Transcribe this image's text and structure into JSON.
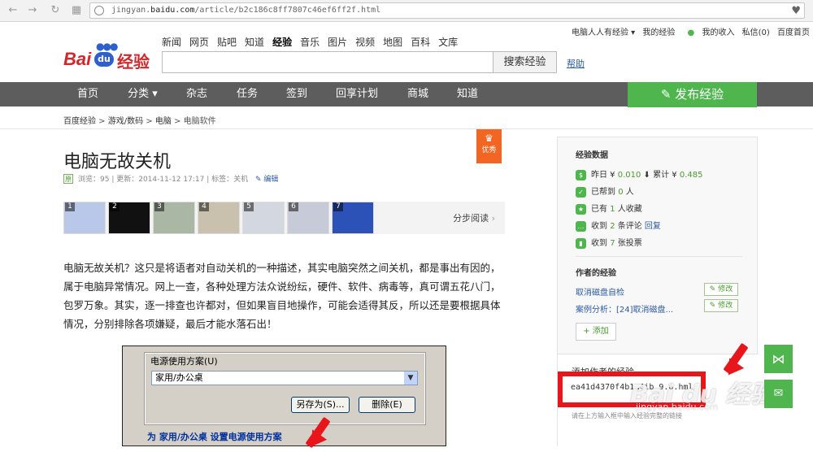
{
  "browser": {
    "url_prefix": "jingyan.",
    "url_domain": "baidu.com",
    "url_path": "/article/b2c186c8ff7807c46ef6ff2f.html"
  },
  "top_links": [
    "电脑人人有经验 ▾",
    "我的经验",
    "我的收入",
    "私信(0)",
    "百度首页"
  ],
  "logo": {
    "bai": "Bai",
    "du": "du",
    "jingyan": "经验"
  },
  "product_nav": [
    "新闻",
    "网页",
    "贴吧",
    "知道",
    "经验",
    "音乐",
    "图片",
    "视频",
    "地图",
    "百科",
    "文库"
  ],
  "product_nav_current": "经验",
  "search": {
    "button": "搜索经验",
    "help": "帮助",
    "value": ""
  },
  "main_nav": {
    "items": [
      "首页",
      "分类 ▾",
      "杂志",
      "任务",
      "签到",
      "回享计划",
      "商城",
      "知道"
    ],
    "publish": "发布经验"
  },
  "breadcrumb": [
    "百度经验",
    "游戏/数码",
    "电脑",
    "电脑软件"
  ],
  "article": {
    "title": "电脑无故关机",
    "badge": "优秀",
    "yuan": "原",
    "views": "浏览：95",
    "updated": "更新：2014-11-12 17:17",
    "tags": "标签：关机",
    "edit": "编辑",
    "steps_label": "分步阅读",
    "thumb_numbers": [
      "1",
      "2",
      "3",
      "4",
      "5",
      "6",
      "7"
    ],
    "paragraph": "电脑无故关机？这只是将语者对自动关机的一种描述，其实电脑突然之间关机，都是事出有因的，属于电脑异常情况。网上一查，各种处理方法众说纷纭，硬件、软件、病毒等，真可谓五花八门，包罗万象。其实，逐一排查也许都对，但如果盲目地操作，可能会适得其反，所以还是要根据具体情况，分别排除各项嫌疑，最后才能水落石出！"
  },
  "screenshot": {
    "group_label": "电源使用方案(U)",
    "selected": "家用/办公桌",
    "save_as": "另存为(S)...",
    "delete": "删除(E)",
    "bottom": "为 家用/办公桌 设置电源使用方案"
  },
  "sidebar": {
    "data_title": "经验数据",
    "stats": [
      {
        "prefix": "昨日 ¥ ",
        "value": "0.010",
        "mid": " ⬇ 累计 ¥ ",
        "value2": "0.485",
        "suffix": ""
      },
      {
        "prefix": "已帮到 ",
        "value": "0",
        "mid": " 人",
        "value2": "",
        "suffix": ""
      },
      {
        "prefix": "已有 ",
        "value": "1",
        "mid": " 人收藏",
        "value2": "",
        "suffix": ""
      },
      {
        "prefix": "收到 ",
        "value": "2",
        "mid": " 条评论 ",
        "value2": "",
        "suffix": "回复"
      },
      {
        "prefix": "收到 ",
        "value": "7",
        "mid": " 张投票",
        "value2": "",
        "suffix": ""
      }
    ],
    "author_title": "作者的经验",
    "author_items": [
      "取消磁盘自检",
      "案例分析：[24]取消磁盘..."
    ],
    "edit_label": "修改",
    "add_label": "+ 添加",
    "add_title": "添加作者的经验",
    "input_value": "ea41d4370f4b1…4ib 9.6.hml",
    "hint": "请在上方输入框中输入经验完整的链接"
  },
  "watermark": {
    "logo": "Bai du 经验",
    "url": "jingyan.baidu.com"
  },
  "colors": {
    "accent": "#4fb64e",
    "brand_red": "#d2282c",
    "nav_bg": "#5d5d5d",
    "link": "#2b5aa8",
    "annotation": "#e8161b"
  }
}
